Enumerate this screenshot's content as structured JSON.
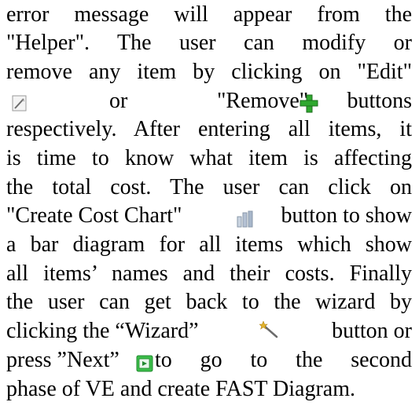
{
  "paragraph": {
    "l1": "error message will appear from the",
    "l2": "\"Helper\". The user can modify or",
    "l3": "remove any item by clicking on \"Edit\"",
    "l4_a": "or",
    "l4_b": "\"Remove\"",
    "l4_c": "buttons",
    "l5": "respectively. After entering all items, it",
    "l6": "is time to know what item is affecting",
    "l7": "the total cost. The user can click on",
    "l8_a": "\"Create Cost Chart\"",
    "l8_b": "button to show",
    "l9": "a bar diagram for all items which show",
    "l10": "all items’ names and their costs. Finally",
    "l11": "the user can get back to the wizard by",
    "l12_a": "clicking the “Wizard”",
    "l12_b": "button or",
    "l13_a": "press ”Next”",
    "l13_b": "to go to the second",
    "l14": "phase of VE and create FAST Diagram."
  },
  "icons": {
    "edit": "pencil-edit-icon",
    "remove": "green-plus-icon",
    "chart": "bar-chart-icon",
    "wizard": "magic-wand-icon",
    "next": "next-arrow-icon"
  },
  "colors": {
    "text": "#000000",
    "plus_green": "#2fa82f",
    "next_green": "#3bbd4a",
    "wand_gold": "#e2b22a"
  }
}
